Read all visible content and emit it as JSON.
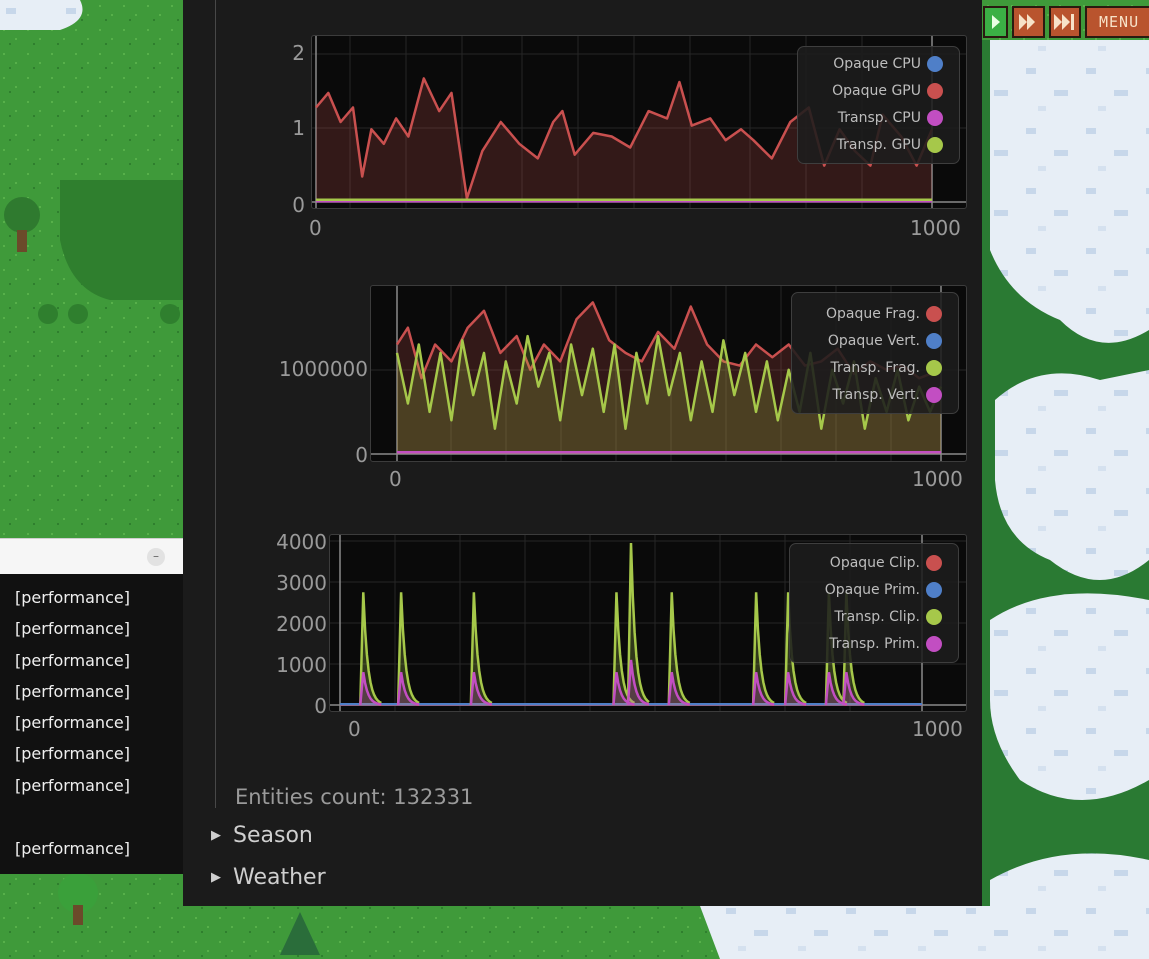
{
  "game": {
    "controls": {
      "play_icon": "play-icon",
      "fast_icon": "fast-forward-icon",
      "faster_icon": "fast-forward-fast-icon",
      "menu_label": "MENU"
    }
  },
  "log_console": {
    "lines": [
      "[performance]",
      "[performance]",
      "[performance]",
      "[performance]",
      "[performance]",
      "[performance]",
      "[performance]",
      "",
      "[performance]"
    ]
  },
  "debug_panel": {
    "plots": [
      {
        "id": "cpu_gpu",
        "x_range": [
          0,
          1000
        ],
        "y_ticks": [
          "2",
          "1",
          "0"
        ],
        "x_ticks": [
          "0",
          "1000"
        ],
        "legend": [
          {
            "label": "Opaque CPU",
            "color": "#4f7fc8"
          },
          {
            "label": "Opaque GPU",
            "color": "#c9504f"
          },
          {
            "label": "Transp. CPU",
            "color": "#c24ec2"
          },
          {
            "label": "Transp. GPU",
            "color": "#a6c84a"
          }
        ]
      },
      {
        "id": "frag_vert",
        "x_range": [
          0,
          1000
        ],
        "y_ticks": [
          "1000000",
          "0"
        ],
        "x_ticks": [
          "0",
          "1000"
        ],
        "legend": [
          {
            "label": "Opaque Frag.",
            "color": "#c9504f"
          },
          {
            "label": "Opaque Vert.",
            "color": "#4f7fc8"
          },
          {
            "label": "Transp. Frag.",
            "color": "#a6c84a"
          },
          {
            "label": "Transp. Vert.",
            "color": "#c24ec2"
          }
        ]
      },
      {
        "id": "clip_prim",
        "x_range": [
          0,
          1000
        ],
        "y_ticks": [
          "4000",
          "3000",
          "2000",
          "1000",
          "0"
        ],
        "x_ticks": [
          "0",
          "1000"
        ],
        "legend": [
          {
            "label": "Opaque Clip.",
            "color": "#c9504f"
          },
          {
            "label": "Opaque Prim.",
            "color": "#4f7fc8"
          },
          {
            "label": "Transp. Clip.",
            "color": "#a6c84a"
          },
          {
            "label": "Transp. Prim.",
            "color": "#c24ec2"
          }
        ]
      }
    ],
    "entities_count": "Entities count: 132331",
    "sections": [
      {
        "label": "Season",
        "expanded": false
      },
      {
        "label": "Weather",
        "expanded": false
      }
    ]
  },
  "chart_data": [
    {
      "type": "line",
      "x_range": [
        0,
        1000
      ],
      "ylim": [
        0,
        2.2
      ],
      "series": [
        {
          "name": "Opaque CPU",
          "color": "#4f7fc8",
          "points": [
            [
              0,
              0.01
            ],
            [
              1000,
              0.01
            ]
          ]
        },
        {
          "name": "Opaque GPU",
          "color": "#c9504f",
          "points": [
            [
              0,
              1.3
            ],
            [
              20,
              1.5
            ],
            [
              40,
              1.1
            ],
            [
              60,
              1.3
            ],
            [
              75,
              0.35
            ],
            [
              90,
              1.0
            ],
            [
              110,
              0.8
            ],
            [
              130,
              1.15
            ],
            [
              150,
              0.9
            ],
            [
              175,
              1.7
            ],
            [
              200,
              1.25
            ],
            [
              220,
              1.5
            ],
            [
              245,
              0.05
            ],
            [
              270,
              0.7
            ],
            [
              300,
              1.1
            ],
            [
              330,
              0.8
            ],
            [
              360,
              0.6
            ],
            [
              385,
              1.1
            ],
            [
              400,
              1.25
            ],
            [
              420,
              0.65
            ],
            [
              450,
              0.95
            ],
            [
              480,
              0.9
            ],
            [
              510,
              0.75
            ],
            [
              540,
              1.25
            ],
            [
              570,
              1.15
            ],
            [
              590,
              1.65
            ],
            [
              610,
              1.05
            ],
            [
              640,
              1.15
            ],
            [
              665,
              0.85
            ],
            [
              690,
              1.0
            ],
            [
              710,
              0.85
            ],
            [
              740,
              0.6
            ],
            [
              770,
              1.1
            ],
            [
              800,
              1.3
            ],
            [
              825,
              0.5
            ],
            [
              850,
              1.0
            ],
            [
              875,
              0.7
            ],
            [
              900,
              0.5
            ],
            [
              920,
              1.2
            ],
            [
              950,
              0.9
            ],
            [
              975,
              0.5
            ],
            [
              1000,
              1.0
            ]
          ]
        },
        {
          "name": "Transp. CPU",
          "color": "#c24ec2",
          "points": [
            [
              0,
              0.01
            ],
            [
              1000,
              0.01
            ]
          ]
        },
        {
          "name": "Transp. GPU",
          "color": "#a6c84a",
          "points": [
            [
              0,
              0.03
            ],
            [
              1000,
              0.03
            ]
          ]
        }
      ]
    },
    {
      "type": "line",
      "x_range": [
        0,
        1000
      ],
      "ylim": [
        0,
        1900000
      ],
      "series": [
        {
          "name": "Opaque Frag.",
          "color": "#c9504f",
          "points": [
            [
              0,
              1300000
            ],
            [
              20,
              1500000
            ],
            [
              45,
              900000
            ],
            [
              70,
              1300000
            ],
            [
              100,
              1100000
            ],
            [
              130,
              1500000
            ],
            [
              160,
              1700000
            ],
            [
              190,
              1200000
            ],
            [
              220,
              1400000
            ],
            [
              245,
              1000000
            ],
            [
              270,
              1300000
            ],
            [
              300,
              1100000
            ],
            [
              330,
              1600000
            ],
            [
              360,
              1800000
            ],
            [
              390,
              1350000
            ],
            [
              420,
              1200000
            ],
            [
              450,
              1100000
            ],
            [
              480,
              1450000
            ],
            [
              510,
              1250000
            ],
            [
              540,
              1750000
            ],
            [
              570,
              1300000
            ],
            [
              600,
              1100000
            ],
            [
              630,
              1050000
            ],
            [
              660,
              1300000
            ],
            [
              690,
              1150000
            ],
            [
              720,
              1300000
            ],
            [
              750,
              1050000
            ],
            [
              780,
              1100000
            ],
            [
              810,
              1250000
            ],
            [
              840,
              950000
            ],
            [
              870,
              1100000
            ],
            [
              900,
              1000000
            ],
            [
              930,
              1050000
            ],
            [
              960,
              900000
            ],
            [
              1000,
              1000000
            ]
          ]
        },
        {
          "name": "Opaque Vert.",
          "color": "#4f7fc8",
          "points": [
            [
              0,
              20000
            ],
            [
              1000,
              20000
            ]
          ]
        },
        {
          "name": "Transp. Frag.",
          "color": "#a6c84a",
          "points": [
            [
              0,
              1200000
            ],
            [
              20,
              600000
            ],
            [
              40,
              1300000
            ],
            [
              60,
              500000
            ],
            [
              80,
              1200000
            ],
            [
              100,
              400000
            ],
            [
              120,
              1350000
            ],
            [
              140,
              700000
            ],
            [
              160,
              1200000
            ],
            [
              180,
              300000
            ],
            [
              200,
              1100000
            ],
            [
              220,
              600000
            ],
            [
              240,
              1400000
            ],
            [
              260,
              800000
            ],
            [
              280,
              1200000
            ],
            [
              300,
              400000
            ],
            [
              320,
              1300000
            ],
            [
              340,
              700000
            ],
            [
              360,
              1250000
            ],
            [
              380,
              500000
            ],
            [
              400,
              1300000
            ],
            [
              420,
              300000
            ],
            [
              440,
              1200000
            ],
            [
              460,
              600000
            ],
            [
              480,
              1400000
            ],
            [
              500,
              700000
            ],
            [
              520,
              1200000
            ],
            [
              540,
              400000
            ],
            [
              560,
              1100000
            ],
            [
              580,
              500000
            ],
            [
              600,
              1350000
            ],
            [
              620,
              700000
            ],
            [
              640,
              1200000
            ],
            [
              660,
              500000
            ],
            [
              680,
              1100000
            ],
            [
              700,
              400000
            ],
            [
              720,
              1000000
            ],
            [
              740,
              500000
            ],
            [
              760,
              1200000
            ],
            [
              780,
              300000
            ],
            [
              800,
              1000000
            ],
            [
              820,
              600000
            ],
            [
              840,
              1100000
            ],
            [
              860,
              300000
            ],
            [
              880,
              900000
            ],
            [
              900,
              500000
            ],
            [
              920,
              1000000
            ],
            [
              940,
              400000
            ],
            [
              960,
              800000
            ],
            [
              980,
              500000
            ],
            [
              1000,
              800000
            ]
          ]
        },
        {
          "name": "Transp. Vert.",
          "color": "#c24ec2",
          "points": [
            [
              0,
              20000
            ],
            [
              1000,
              20000
            ]
          ]
        }
      ]
    },
    {
      "type": "line",
      "x_range": [
        0,
        1000
      ],
      "ylim": [
        0,
        4000
      ],
      "series": [
        {
          "name": "Opaque Clip.",
          "color": "#c9504f",
          "points": [
            [
              0,
              5
            ],
            [
              1000,
              5
            ]
          ]
        },
        {
          "name": "Opaque Prim.",
          "color": "#4f7fc8",
          "points": [
            [
              0,
              20
            ],
            [
              1000,
              20
            ]
          ]
        },
        {
          "name": "Transp. Clip.",
          "color": "#a6c84a",
          "points": [
            [
              40,
              2750
            ],
            [
              105,
              2750
            ],
            [
              230,
              2750
            ],
            [
              475,
              2750
            ],
            [
              500,
              3950
            ],
            [
              570,
              2750
            ],
            [
              715,
              2750
            ],
            [
              770,
              2750
            ],
            [
              840,
              2750
            ],
            [
              870,
              2750
            ]
          ]
        },
        {
          "name": "Transp. Prim.",
          "color": "#c24ec2",
          "points": [
            [
              40,
              800
            ],
            [
              105,
              800
            ],
            [
              230,
              800
            ],
            [
              475,
              800
            ],
            [
              500,
              1100
            ],
            [
              570,
              800
            ],
            [
              715,
              800
            ],
            [
              770,
              800
            ],
            [
              840,
              800
            ],
            [
              870,
              800
            ]
          ]
        }
      ]
    }
  ]
}
